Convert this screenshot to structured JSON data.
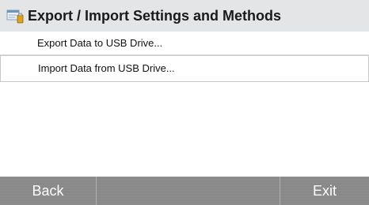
{
  "header": {
    "title": "Export / Import Settings and Methods",
    "icon": "usb-drive-icon"
  },
  "menu": {
    "items": [
      {
        "label": "Export Data to USB Drive..."
      },
      {
        "label": "Import  Data from USB Drive..."
      }
    ]
  },
  "softkeys": {
    "back": "Back",
    "middle": "",
    "exit": "Exit"
  }
}
